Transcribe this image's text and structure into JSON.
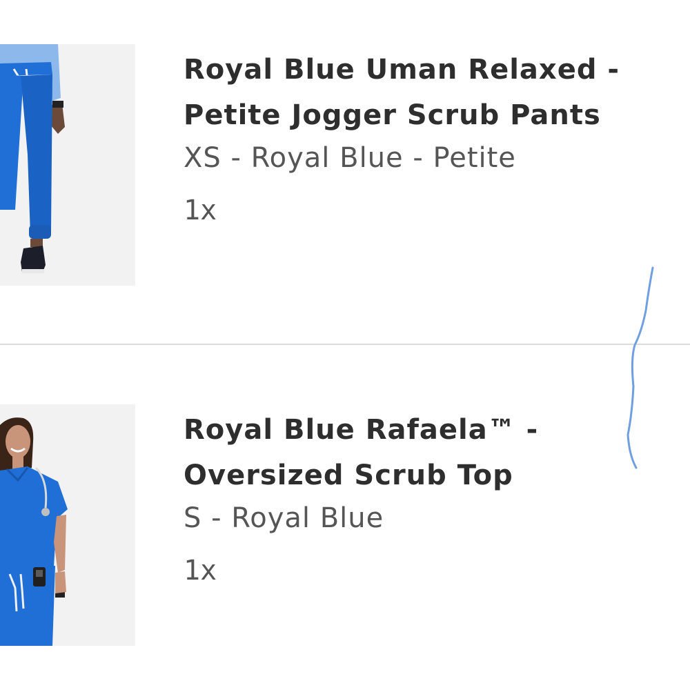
{
  "cart": {
    "items": [
      {
        "name": "Royal Blue Uman Relaxed - Petite Jogger Scrub Pants",
        "variant": "XS - Royal Blue - Petite",
        "quantity": "1x",
        "image_icon": "product-photo-jogger-pants"
      },
      {
        "name": "Royal Blue Rafaela™ - Oversized Scrub Top",
        "variant": "S - Royal Blue",
        "quantity": "1x",
        "image_icon": "product-photo-scrub-top"
      }
    ]
  },
  "colors": {
    "royal_blue": "#1f6fd6",
    "divider": "#dcdcdc",
    "pen_stroke": "#6f9fe0"
  }
}
